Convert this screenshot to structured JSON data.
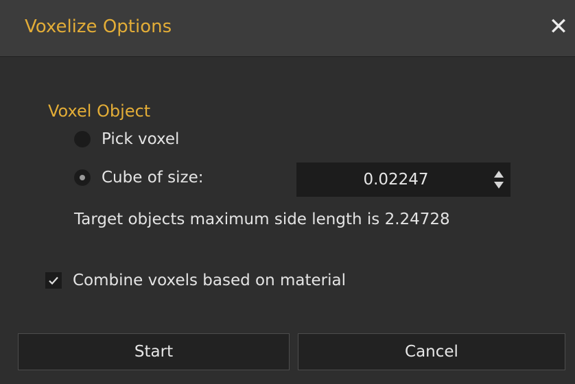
{
  "dialog": {
    "title": "Voxelize Options",
    "close_glyph": "✕"
  },
  "voxel_object": {
    "section_label": "Voxel Object",
    "options": [
      {
        "label": "Pick voxel",
        "selected": false
      },
      {
        "label": "Cube of size:",
        "selected": true
      }
    ],
    "cube_size": "0.02247",
    "info_text": "Target objects maximum side length is  2.24728"
  },
  "combine": {
    "label": "Combine voxels based on material",
    "checked": true
  },
  "buttons": {
    "start": "Start",
    "cancel": "Cancel"
  },
  "colors": {
    "accent": "#e3ad37",
    "background": "#2e2e2e",
    "titlebar": "#3c3c3c",
    "field": "#1c1c1c"
  },
  "icons": {
    "close": "close-icon",
    "spin_up": "arrow-up-icon",
    "spin_down": "arrow-down-icon",
    "check": "checkmark-icon"
  }
}
